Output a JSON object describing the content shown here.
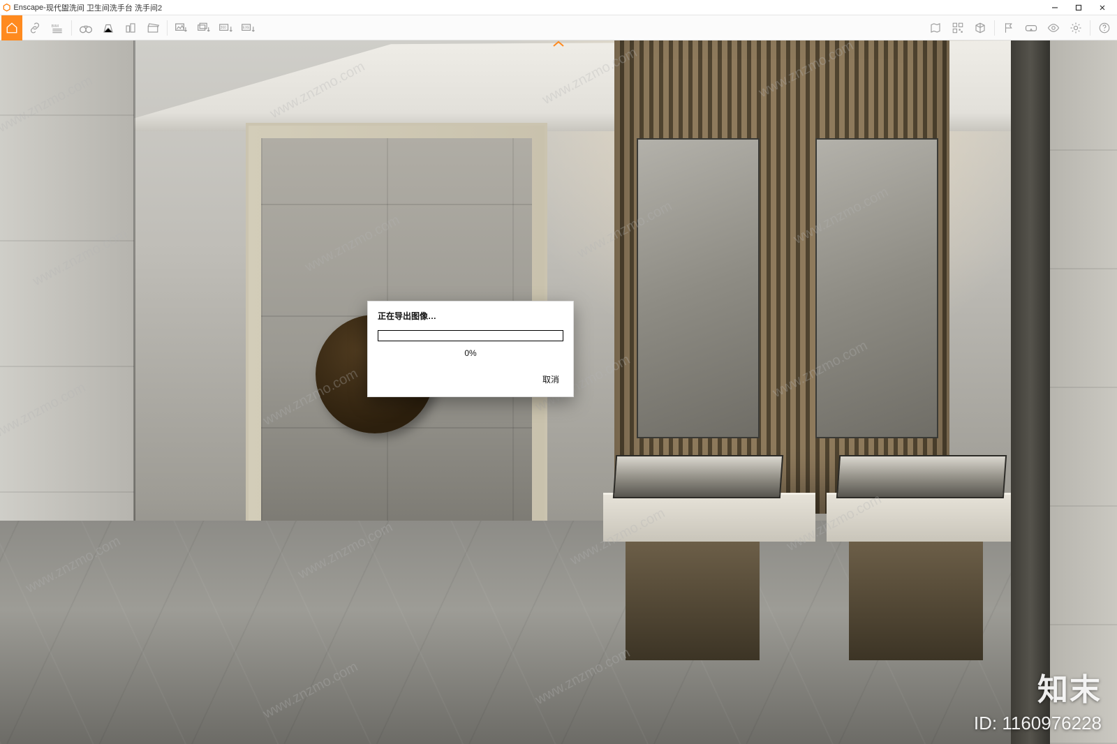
{
  "window": {
    "app_name": "Enscape",
    "title_separator": " - ",
    "document_title": "现代盥洗间 卫生间洗手台 洗手间2"
  },
  "window_controls": {
    "minimize": "minimize",
    "maximize": "maximize",
    "close": "close"
  },
  "toolbar_left": [
    {
      "name": "home",
      "label": "Home"
    },
    {
      "name": "link",
      "label": "Live link"
    },
    {
      "name": "bim-info",
      "label": "BIM"
    },
    {
      "name": "binoculars",
      "label": "Views"
    },
    {
      "name": "perspective",
      "label": "Perspective"
    },
    {
      "name": "buildings",
      "label": "Asset Library"
    },
    {
      "name": "clapper",
      "label": "Video Path"
    }
  ],
  "toolbar_export": [
    {
      "name": "export-image",
      "label": "Export Image"
    },
    {
      "name": "export-batch",
      "label": "Batch Render"
    },
    {
      "name": "export-pano",
      "label": "360° Panorama"
    },
    {
      "name": "export-exe",
      "label": "EXE Standalone"
    }
  ],
  "toolbar_right": [
    {
      "name": "map",
      "label": "Mini map"
    },
    {
      "name": "qr",
      "label": "QR Upload"
    },
    {
      "name": "cube",
      "label": "3D"
    },
    {
      "name": "flag",
      "label": "Views list"
    },
    {
      "name": "vr",
      "label": "VR Headset"
    },
    {
      "name": "eye",
      "label": "Visual Settings"
    },
    {
      "name": "gear",
      "label": "Settings"
    },
    {
      "name": "help",
      "label": "Help"
    }
  ],
  "dialog": {
    "title": "正在导出图像…",
    "percent_text": "0%",
    "percent_value": 0,
    "cancel_label": "取消"
  },
  "watermark": {
    "brand": "知末",
    "id_label": "ID: 1160976228",
    "url": "www.znzmo.com"
  }
}
